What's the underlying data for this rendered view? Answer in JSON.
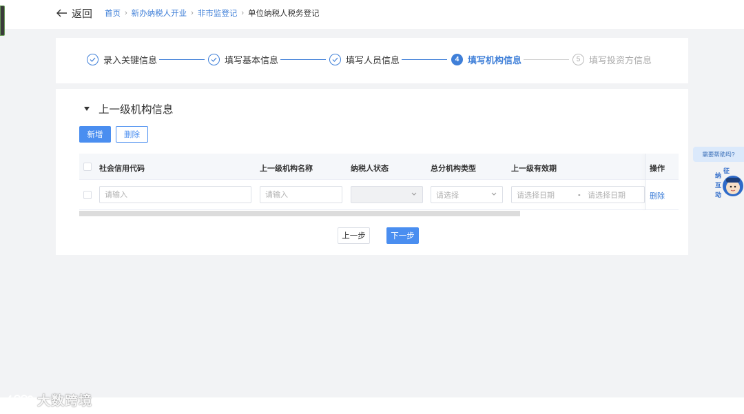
{
  "header": {
    "back_label": "返回",
    "breadcrumb": [
      "首页",
      "新办纳税人开业",
      "非市监登记"
    ],
    "breadcrumb_current": "单位纳税人税务登记"
  },
  "steps": [
    {
      "label": "录入关键信息",
      "status": "done"
    },
    {
      "label": "填写基本信息",
      "status": "done"
    },
    {
      "label": "填写人员信息",
      "status": "done"
    },
    {
      "number": "4",
      "label": "填写机构信息",
      "status": "active"
    },
    {
      "number": "5",
      "label": "填写投资方信息",
      "status": "todo"
    }
  ],
  "section": {
    "title": "上一级机构信息",
    "add_label": "新增",
    "delete_label": "删除"
  },
  "table": {
    "columns": [
      "社会信用代码",
      "上一级机构名称",
      "纳税人状态",
      "总分机构类型",
      "上一级有效期",
      "操作"
    ],
    "row": {
      "credit_code_placeholder": "请输入",
      "name_placeholder": "请输入",
      "status_value": "",
      "type_placeholder": "请选择",
      "date_start_placeholder": "请选择日期",
      "date_sep": "-",
      "date_end_placeholder": "请选择日期",
      "action_label": "删除"
    }
  },
  "nav": {
    "prev_label": "上一步",
    "next_label": "下一步"
  },
  "help": {
    "bubble": "需要帮助吗?",
    "mascot_text": "征纳互动"
  },
  "watermark": "大数跨境",
  "colors": {
    "accent": "#3f7fd8",
    "primary_button": "#4a8ef0",
    "background": "#f2f3f5"
  }
}
